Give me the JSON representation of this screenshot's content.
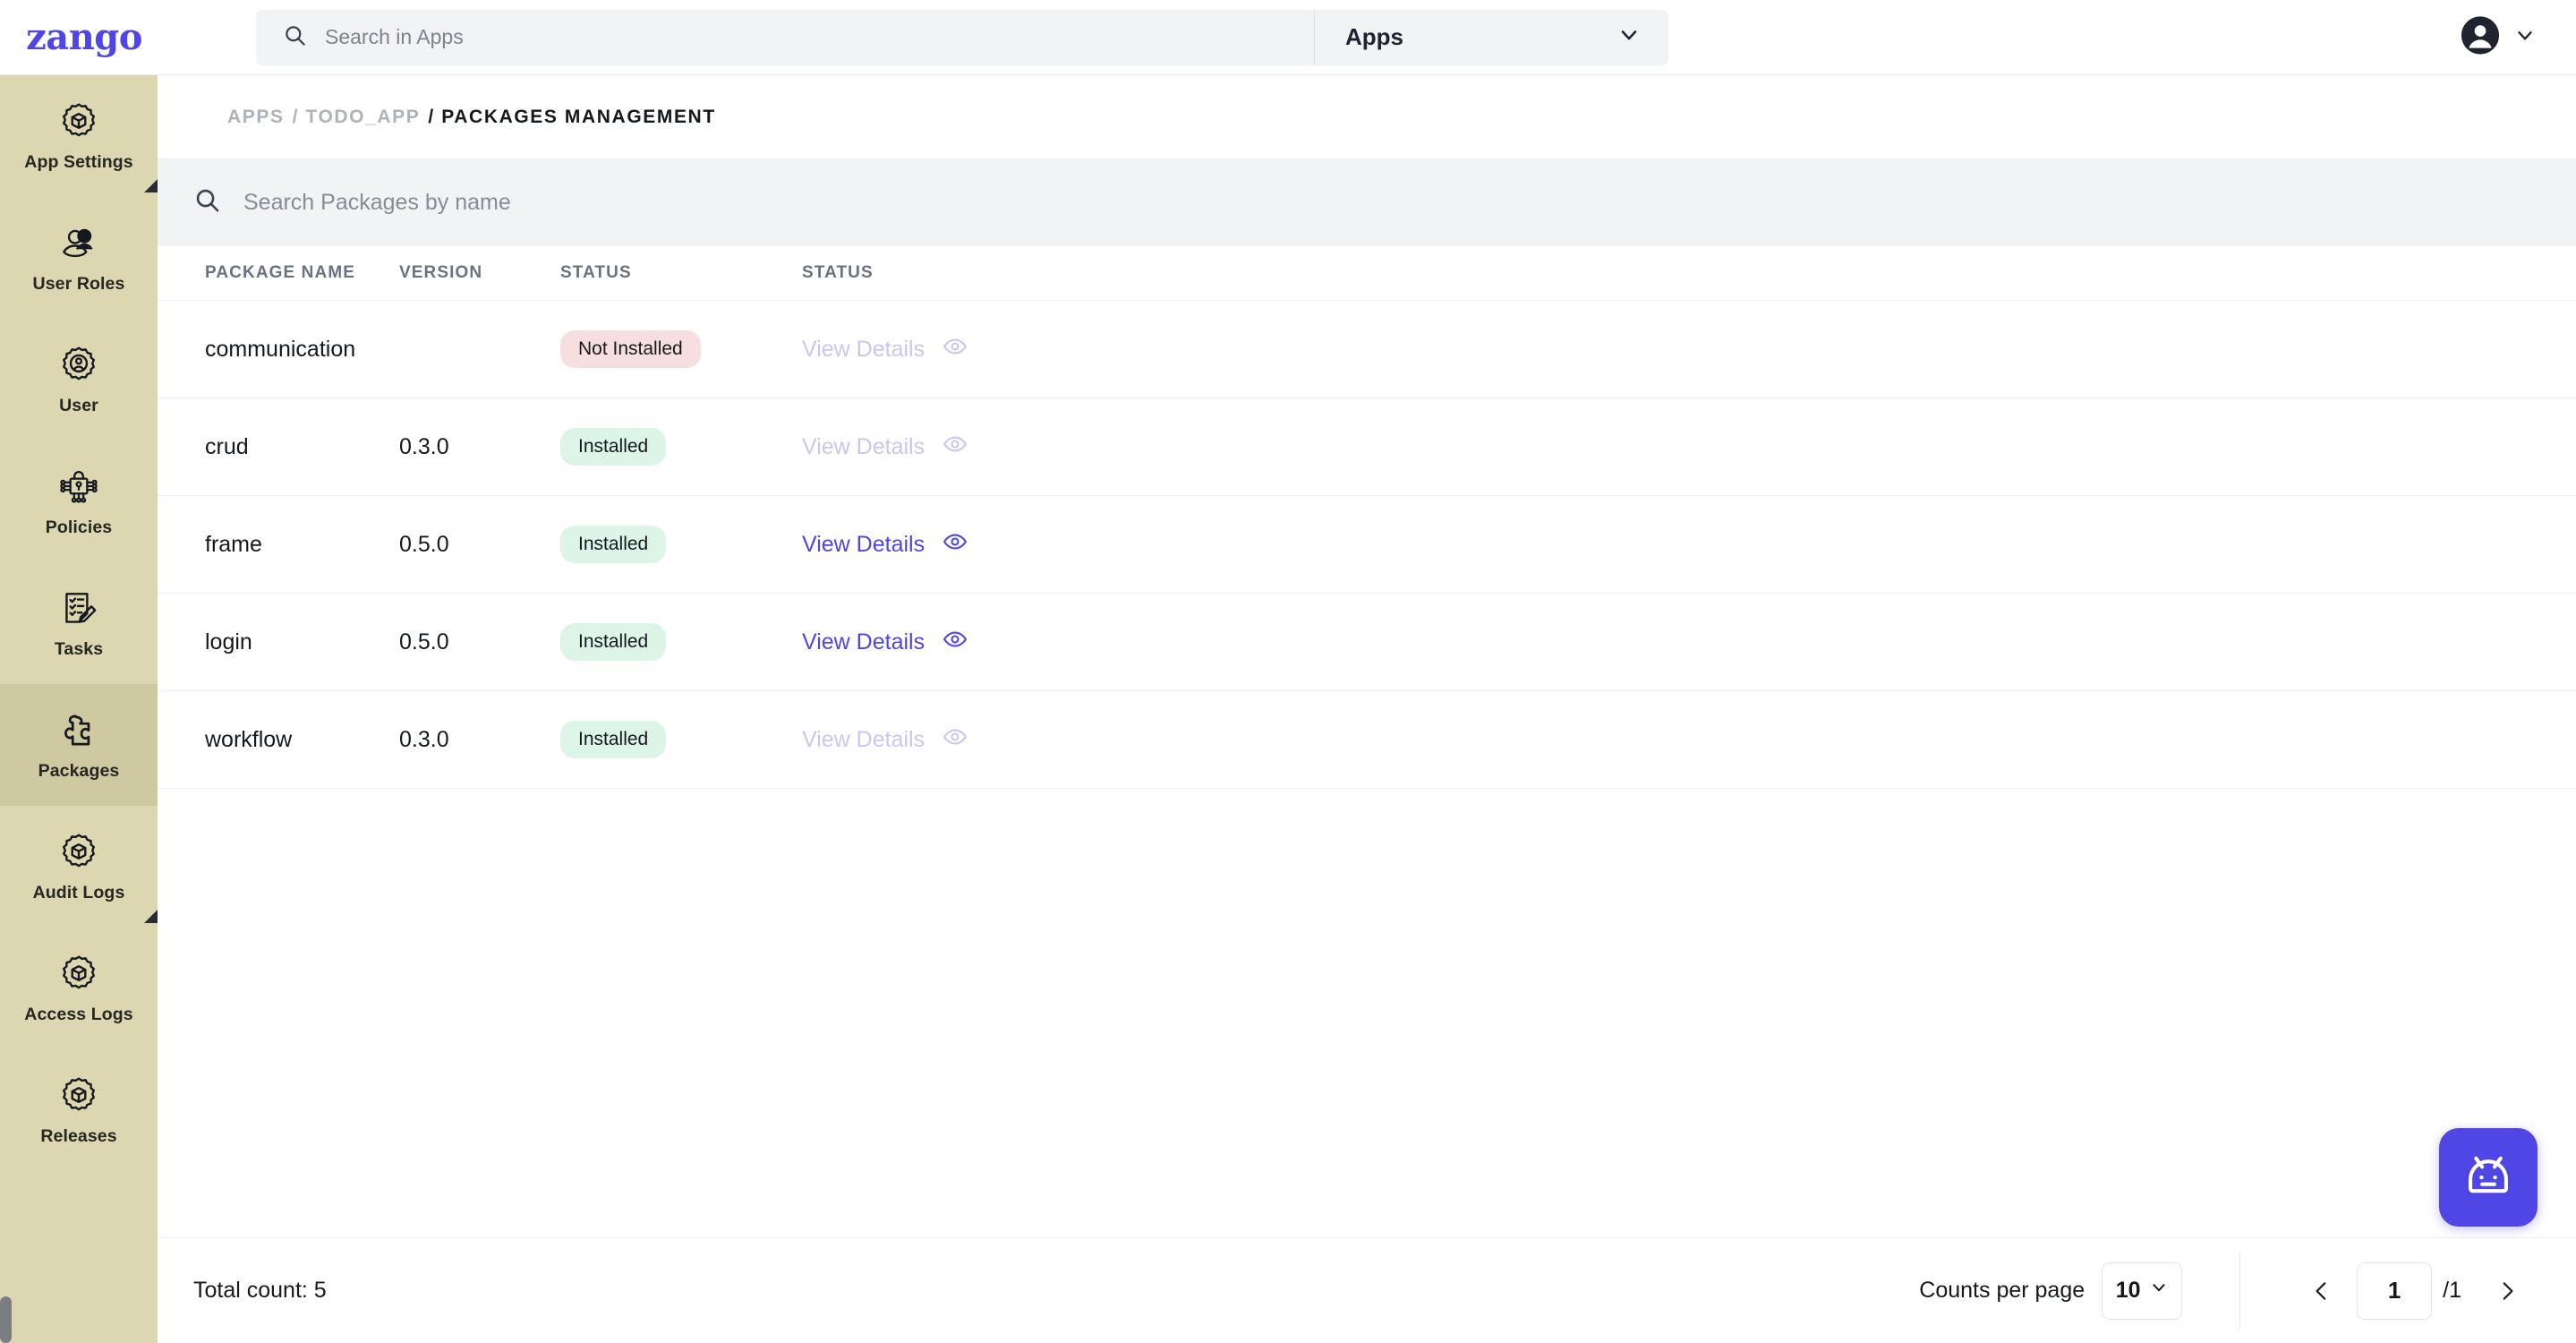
{
  "brand": {
    "logo_text": "zango",
    "accent": "#4f46e5"
  },
  "topbar": {
    "search": {
      "placeholder": "Search in Apps",
      "value": ""
    },
    "app_selector": {
      "label": "Apps"
    }
  },
  "sidebar": {
    "items": [
      {
        "label": "App Settings",
        "icon": "gear-cube-icon",
        "active": false,
        "has_marker": true
      },
      {
        "label": "User Roles",
        "icon": "users-icon",
        "active": false,
        "has_marker": false
      },
      {
        "label": "User",
        "icon": "gear-user-icon",
        "active": false,
        "has_marker": false
      },
      {
        "label": "Policies",
        "icon": "policy-lock-icon",
        "active": false,
        "has_marker": false
      },
      {
        "label": "Tasks",
        "icon": "checklist-pencil-icon",
        "active": false,
        "has_marker": false
      },
      {
        "label": "Packages",
        "icon": "puzzle-piece-icon",
        "active": true,
        "has_marker": false
      },
      {
        "label": "Audit Logs",
        "icon": "gear-cube-icon",
        "active": false,
        "has_marker": true
      },
      {
        "label": "Access Logs",
        "icon": "gear-cube-icon",
        "active": false,
        "has_marker": false
      },
      {
        "label": "Releases",
        "icon": "gear-cube-icon",
        "active": false,
        "has_marker": false
      }
    ]
  },
  "breadcrumb": {
    "items": [
      {
        "label": "APPS",
        "current": false
      },
      {
        "label": "TODO_APP",
        "current": false
      },
      {
        "label": "PACKAGES MANAGEMENT",
        "current": true
      }
    ]
  },
  "package_search": {
    "placeholder": "Search Packages by name",
    "value": ""
  },
  "table": {
    "columns": [
      "PACKAGE NAME",
      "VERSION",
      "STATUS",
      "STATUS"
    ],
    "rows": [
      {
        "name": "communication",
        "version": "",
        "status": "Not Installed",
        "status_kind": "notinstalled",
        "action_label": "View Details",
        "action_enabled": false
      },
      {
        "name": "crud",
        "version": "0.3.0",
        "status": "Installed",
        "status_kind": "installed",
        "action_label": "View Details",
        "action_enabled": false
      },
      {
        "name": "frame",
        "version": "0.5.0",
        "status": "Installed",
        "status_kind": "installed",
        "action_label": "View Details",
        "action_enabled": true
      },
      {
        "name": "login",
        "version": "0.5.0",
        "status": "Installed",
        "status_kind": "installed",
        "action_label": "View Details",
        "action_enabled": true
      },
      {
        "name": "workflow",
        "version": "0.3.0",
        "status": "Installed",
        "status_kind": "installed",
        "action_label": "View Details",
        "action_enabled": false
      }
    ]
  },
  "footer": {
    "total_count_label": "Total count: 5",
    "counts_per_page_label": "Counts per page",
    "counts_per_page_value": "10",
    "page_value": "1",
    "page_total": "/1"
  },
  "fab": {
    "icon": "robot-bot-icon"
  },
  "colors": {
    "sidebar_bg": "#ddd7b1",
    "sidebar_active_bg": "#cfc9a2",
    "installed_badge_bg": "#dcf5e7",
    "not_installed_badge_bg": "#f8dfdf",
    "search_bg": "#f1f3f5"
  }
}
